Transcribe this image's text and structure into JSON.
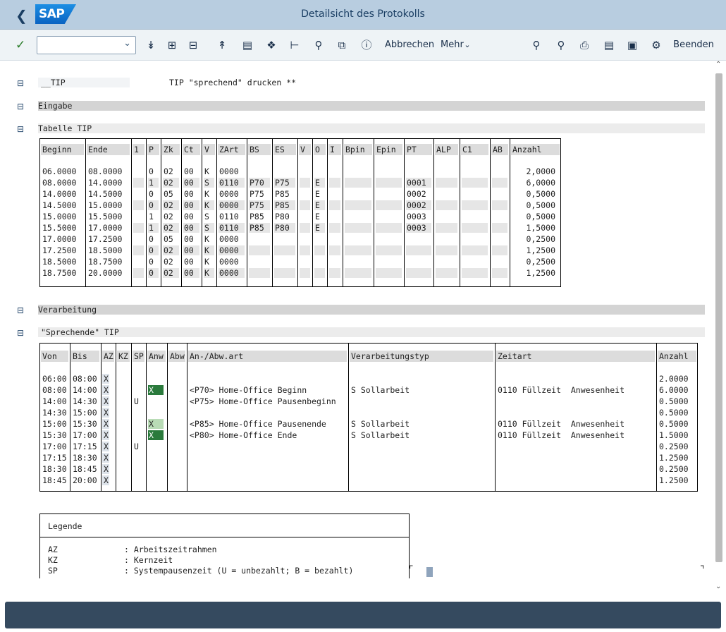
{
  "app": {
    "title": "Detailsicht des Protokolls",
    "logo": "SAP",
    "back_icon": "chevron-left-icon"
  },
  "toolbar": {
    "confirm_icon": "check-icon",
    "command_placeholder": "",
    "cancel_label": "Abbrechen",
    "more_label": "Mehr",
    "exit_label": "Beenden",
    "left_icons": [
      "expand-all-icon",
      "expand-icon",
      "collapse-icon",
      "collapse-all-icon",
      "print-preview-icon",
      "settings-icon",
      "hierarchy-icon",
      "search-plus-icon",
      "copy-icon",
      "info-icon"
    ],
    "right_icons": [
      "search-icon",
      "search-next-icon",
      "print-icon",
      "window-new-icon",
      "window-icon",
      "customize-icon"
    ]
  },
  "tree": {
    "tip_node": "__TIP",
    "tip_text": "TIP \"sprechend\" drucken **",
    "eingabe": "Eingabe",
    "tabelle_tip": "Tabelle TIP",
    "verarbeitung": "Verarbeitung",
    "sprechende_tip": "\"Sprechende\" TIP"
  },
  "table1": {
    "headers": [
      "Beginn",
      "Ende",
      "1",
      "P",
      "Zk",
      "Ct",
      "V",
      "ZArt",
      "BS",
      "ES",
      "V",
      "O",
      "I",
      "Bpin",
      "Epin",
      "PT",
      "ALP",
      "C1",
      "AB",
      "Anzahl"
    ],
    "rows": [
      [
        "06.0000",
        "08.0000",
        "",
        "0",
        "02",
        "00",
        "K",
        "0000",
        "",
        "",
        "",
        "",
        "",
        "",
        "",
        "",
        "",
        "",
        "",
        "2,0000"
      ],
      [
        "08.0000",
        "14.0000",
        "",
        "1",
        "02",
        "00",
        "S",
        "0110",
        "P70",
        "P75",
        "",
        "E",
        "",
        "",
        "",
        "0001",
        "",
        "",
        "",
        "6,0000"
      ],
      [
        "14.0000",
        "14.5000",
        "",
        "0",
        "05",
        "00",
        "K",
        "0000",
        "P75",
        "P85",
        "",
        "E",
        "",
        "",
        "",
        "0002",
        "",
        "",
        "",
        "0,5000"
      ],
      [
        "14.5000",
        "15.0000",
        "",
        "0",
        "02",
        "00",
        "K",
        "0000",
        "P75",
        "P85",
        "",
        "E",
        "",
        "",
        "",
        "0002",
        "",
        "",
        "",
        "0,5000"
      ],
      [
        "15.0000",
        "15.5000",
        "",
        "1",
        "02",
        "00",
        "S",
        "0110",
        "P85",
        "P80",
        "",
        "E",
        "",
        "",
        "",
        "0003",
        "",
        "",
        "",
        "0,5000"
      ],
      [
        "15.5000",
        "17.0000",
        "",
        "1",
        "02",
        "00",
        "S",
        "0110",
        "P85",
        "P80",
        "",
        "E",
        "",
        "",
        "",
        "0003",
        "",
        "",
        "",
        "1,5000"
      ],
      [
        "17.0000",
        "17.2500",
        "",
        "0",
        "05",
        "00",
        "K",
        "0000",
        "",
        "",
        "",
        "",
        "",
        "",
        "",
        "",
        "",
        "",
        "",
        "0,2500"
      ],
      [
        "17.2500",
        "18.5000",
        "",
        "0",
        "02",
        "00",
        "K",
        "0000",
        "",
        "",
        "",
        "",
        "",
        "",
        "",
        "",
        "",
        "",
        "",
        "1,2500"
      ],
      [
        "18.5000",
        "18.7500",
        "",
        "0",
        "02",
        "00",
        "K",
        "0000",
        "",
        "",
        "",
        "",
        "",
        "",
        "",
        "",
        "",
        "",
        "",
        "0,2500"
      ],
      [
        "18.7500",
        "20.0000",
        "",
        "0",
        "02",
        "00",
        "K",
        "0000",
        "",
        "",
        "",
        "",
        "",
        "",
        "",
        "",
        "",
        "",
        "",
        "1,2500"
      ]
    ]
  },
  "table2": {
    "headers": [
      "Von",
      "Bis",
      "AZ",
      "KZ",
      "SP",
      "Anw",
      "Abw",
      "An-/Abw.art",
      "Verarbeitungstyp",
      "Zeitart",
      "Anzahl"
    ],
    "rows": [
      [
        "06:00",
        "08:00",
        "X",
        "",
        "",
        "",
        "",
        "",
        "",
        "",
        "2.0000"
      ],
      [
        "08:00",
        "14:00",
        "X",
        "",
        "",
        "X",
        "",
        "<P70> Home-Office Beginn",
        "S Sollarbeit",
        "0110 Füllzeit  Anwesenheit",
        "6.0000"
      ],
      [
        "14:00",
        "14:30",
        "X",
        "",
        "U",
        "",
        "",
        "<P75> Home-Office Pausenbeginn",
        "",
        "",
        "0.5000"
      ],
      [
        "14:30",
        "15:00",
        "X",
        "",
        "",
        "",
        "",
        "",
        "",
        "",
        "0.5000"
      ],
      [
        "15:00",
        "15:30",
        "X",
        "",
        "",
        "X",
        "",
        "<P85> Home-Office Pausenende",
        "S Sollarbeit",
        "0110 Füllzeit  Anwesenheit",
        "0.5000"
      ],
      [
        "15:30",
        "17:00",
        "X",
        "",
        "",
        "X",
        "",
        "<P80> Home-Office Ende",
        "S Sollarbeit",
        "0110 Füllzeit  Anwesenheit",
        "1.5000"
      ],
      [
        "17:00",
        "17:15",
        "X",
        "",
        "U",
        "",
        "",
        "",
        "",
        "",
        "0.2500"
      ],
      [
        "17:15",
        "18:30",
        "X",
        "",
        "",
        "",
        "",
        "",
        "",
        "",
        "1.2500"
      ],
      [
        "18:30",
        "18:45",
        "X",
        "",
        "",
        "",
        "",
        "",
        "",
        "",
        "0.2500"
      ],
      [
        "18:45",
        "20:00",
        "X",
        "",
        "",
        "",
        "",
        "",
        "",
        "",
        "1.2500"
      ]
    ]
  },
  "legend": {
    "title": "Legende",
    "items": [
      [
        "AZ",
        ": Arbeitszeitrahmen"
      ],
      [
        "KZ",
        ": Kernzeit"
      ],
      [
        "SP",
        ": Systempausenzeit (U = unbezahlt; B = bezahlt)"
      ]
    ]
  }
}
